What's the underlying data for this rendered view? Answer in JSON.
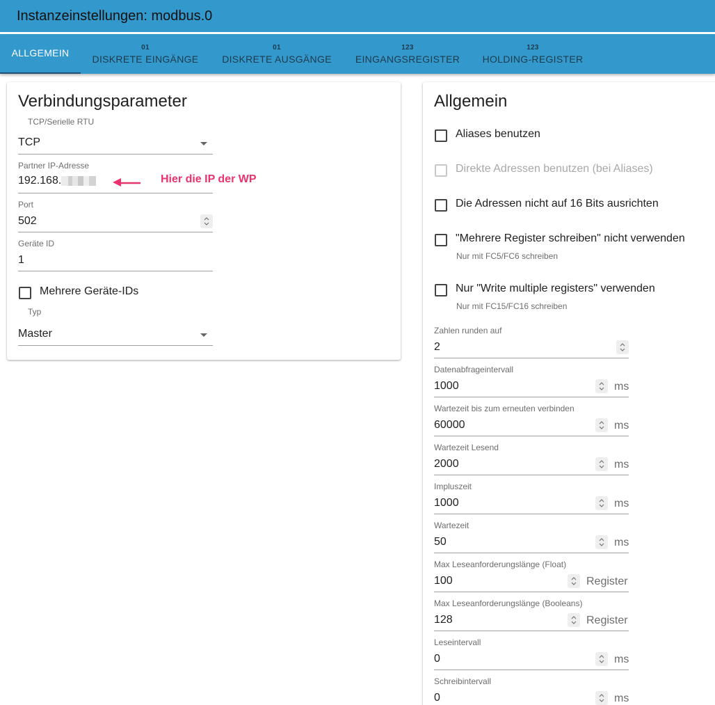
{
  "window": {
    "title": "Instanzeinstellungen: modbus.0"
  },
  "tabs": [
    {
      "label": "ALLGEMEIN",
      "icon": ""
    },
    {
      "label": "DISKRETE EINGÄNGE",
      "icon": "01"
    },
    {
      "label": "DISKRETE AUSGÄNGE",
      "icon": "01"
    },
    {
      "label": "EINGANGSREGISTER",
      "icon": "123"
    },
    {
      "label": "HOLDING-REGISTER",
      "icon": "123"
    }
  ],
  "connection": {
    "title": "Verbindungsparameter",
    "protocol": {
      "label": "TCP/Serielle RTU",
      "value": "TCP"
    },
    "ip": {
      "label": "Partner IP-Adresse",
      "value": "192.168."
    },
    "annotation": "Hier die IP der WP",
    "port": {
      "label": "Port",
      "value": "502"
    },
    "device_id": {
      "label": "Geräte ID",
      "value": "1"
    },
    "multi_ids": {
      "label": "Mehrere Geräte-IDs"
    },
    "type": {
      "label": "Typ",
      "value": "Master"
    }
  },
  "general": {
    "title": "Allgemein",
    "checkboxes": [
      {
        "label": "Aliases benutzen",
        "hint": "",
        "checked": false,
        "disabled": false
      },
      {
        "label": "Direkte Adressen benutzen (bei Aliases)",
        "hint": "",
        "checked": false,
        "disabled": true
      },
      {
        "label": "Die Adressen nicht auf 16 Bits ausrichten",
        "hint": "",
        "checked": false,
        "disabled": false
      },
      {
        "label": "\"Mehrere Register schreiben\" nicht verwenden",
        "hint": "Nur mit FC5/FC6 schreiben",
        "checked": false,
        "disabled": false
      },
      {
        "label": "Nur \"Write multiple registers\" verwenden",
        "hint": "Nur mit FC15/FC16 schreiben",
        "checked": false,
        "disabled": false
      }
    ],
    "fields": [
      {
        "label": "Zahlen runden auf",
        "value": "2",
        "unit": ""
      },
      {
        "label": "Datenabfrageintervall",
        "value": "1000",
        "unit": "ms"
      },
      {
        "label": "Wartezeit bis zum erneuten verbinden",
        "value": "60000",
        "unit": "ms"
      },
      {
        "label": "Wartezeit Lesend",
        "value": "2000",
        "unit": "ms"
      },
      {
        "label": "Impluszeit",
        "value": "1000",
        "unit": "ms"
      },
      {
        "label": "Wartezeit",
        "value": "50",
        "unit": "ms"
      },
      {
        "label": "Max Leseanforderungslänge (Float)",
        "value": "100",
        "unit": "Register"
      },
      {
        "label": "Max Leseanforderungslänge (Booleans)",
        "value": "128",
        "unit": "Register"
      },
      {
        "label": "Leseintervall",
        "value": "0",
        "unit": "ms"
      },
      {
        "label": "Schreibintervall",
        "value": "0",
        "unit": "ms"
      }
    ]
  }
}
